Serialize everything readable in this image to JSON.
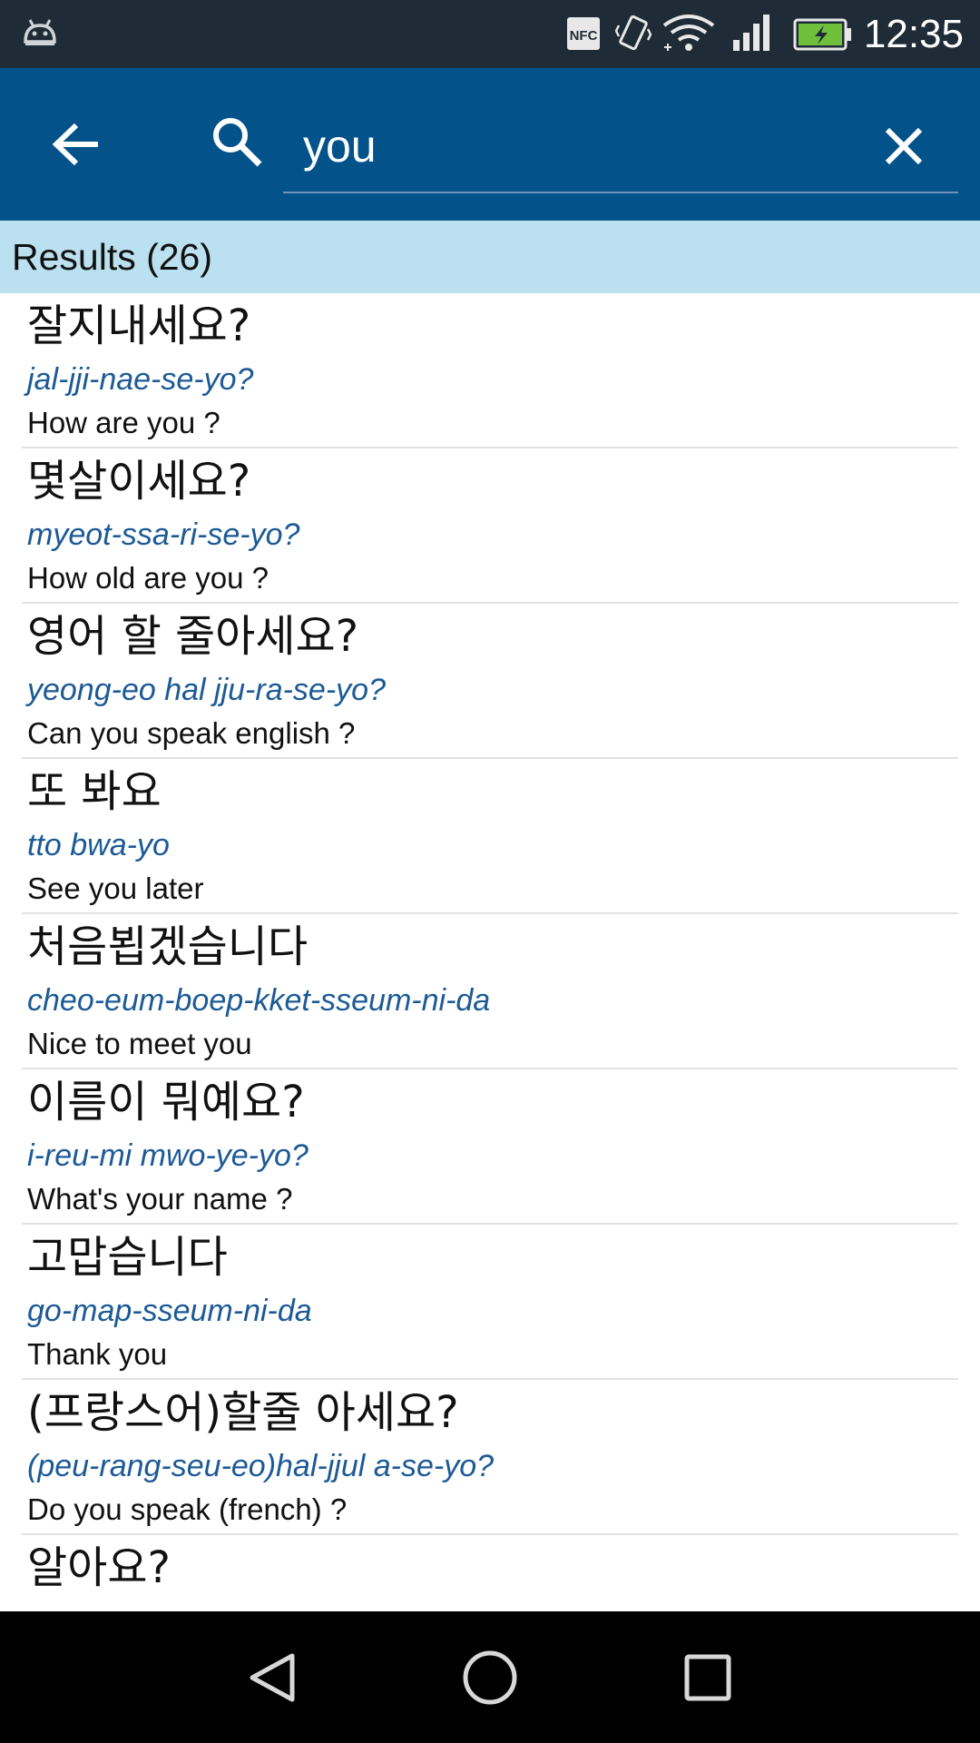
{
  "status_bar": {
    "time": "12:35",
    "icons": [
      "android-icon",
      "nfc-icon",
      "vibrate-icon",
      "wifi-icon",
      "signal-icon",
      "battery-charging-icon"
    ]
  },
  "search": {
    "value": "you",
    "icons": [
      "back-arrow-icon",
      "search-icon",
      "close-icon"
    ]
  },
  "results": {
    "header": "Results (26)",
    "items": [
      {
        "korean": "잘지내세요?",
        "romanization": "jal-jji-nae-se-yo?",
        "english": "How are you ?"
      },
      {
        "korean": "몇살이세요?",
        "romanization": "myeot-ssa-ri-se-yo?",
        "english": "How old are you ?"
      },
      {
        "korean": "영어 할 줄아세요?",
        "romanization": "yeong-eo hal jju-ra-se-yo?",
        "english": "Can you speak english ?"
      },
      {
        "korean": "또 봐요",
        "romanization": "tto bwa-yo",
        "english": "See you later"
      },
      {
        "korean": "처음뵙겠습니다",
        "romanization": "cheo-eum-boep-kket-sseum-ni-da",
        "english": "Nice to meet you"
      },
      {
        "korean": "이름이 뭐예요?",
        "romanization": "i-reu-mi mwo-ye-yo?",
        "english": "What's your name ?"
      },
      {
        "korean": "고맙습니다",
        "romanization": "go-map-sseum-ni-da",
        "english": "Thank you"
      },
      {
        "korean": "(프랑스어)할줄 아세요?",
        "romanization": "(peu-rang-seu-eo)hal-jjul a-se-yo?",
        "english": "Do you speak (french) ?"
      },
      {
        "korean": "알아요?",
        "romanization": "",
        "english": ""
      }
    ]
  },
  "nav_bar": {
    "icons": [
      "back-triangle-icon",
      "home-circle-icon",
      "recents-square-icon"
    ]
  },
  "colors": {
    "status_bar": "#1f2c37",
    "app_bar": "#03538a",
    "results_header": "#bbe1f0",
    "romanization": "#1c5a96",
    "nav_bar": "#000000"
  }
}
